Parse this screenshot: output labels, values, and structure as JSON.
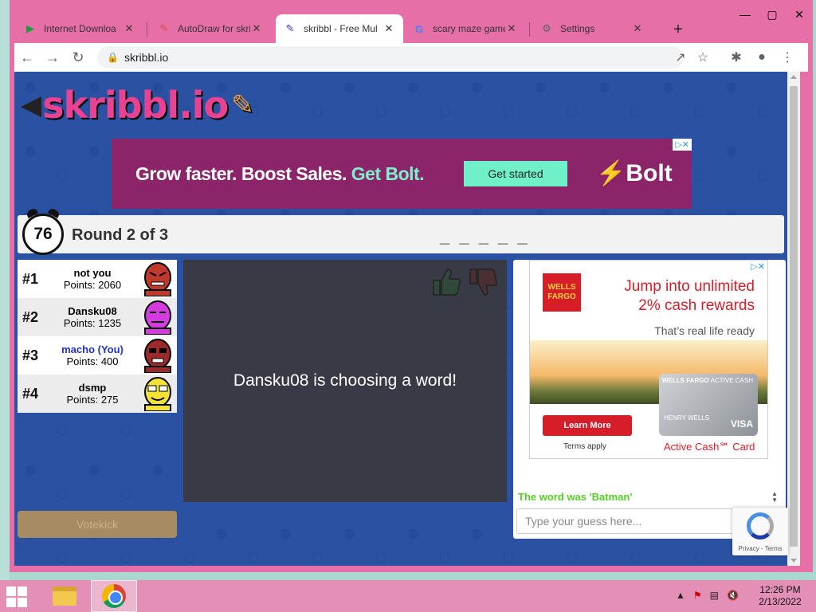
{
  "browser": {
    "tabs": [
      {
        "title": "Internet Downloa",
        "icon": "play-icon"
      },
      {
        "title": "AutoDraw for skri",
        "icon": "autodraw-icon"
      },
      {
        "title": "skribbl - Free Mul",
        "icon": "pencil-icon"
      },
      {
        "title": "scary maze game",
        "icon": "google-icon"
      },
      {
        "title": "Settings",
        "icon": "gear-icon"
      }
    ],
    "url": "skribbl.io"
  },
  "game": {
    "logo": "skribbl.io",
    "timer": "76",
    "round": "Round 2 of 3",
    "word_hint": "_ _ _ _ _",
    "canvas_message": "Dansku08 is choosing a word!",
    "votekick": "Votekick",
    "players": [
      {
        "rank": "#1",
        "name": "not you",
        "points": "Points: 2060",
        "color": "#c0392b"
      },
      {
        "rank": "#2",
        "name": "Dansku08",
        "points": "Points: 1235",
        "color": "#d63be0"
      },
      {
        "rank": "#3",
        "name": "macho (You)",
        "points": "Points: 400",
        "color": "#9c2a2a"
      },
      {
        "rank": "#4",
        "name": "dsmp",
        "points": "Points: 275",
        "color": "#f2e233"
      }
    ],
    "chat_message": "The word was 'Batman'",
    "guess_placeholder": "Type your guess here..."
  },
  "ads": {
    "top_headline_a": "Grow faster. Boost Sales.",
    "top_headline_b": "Get Bolt.",
    "top_cta": "Get started",
    "top_brand": "Bolt",
    "side_logo": "WELLS FARGO",
    "side_line1": "Jump into unlimited",
    "side_line2": "2% cash rewards",
    "side_line3": "That’s real life ready",
    "side_cta": "Learn More",
    "side_terms": "Terms apply",
    "side_card_brand": "WELLS FARGO",
    "side_card_type": "ACTIVE CASH",
    "side_card_holder": "HENRY WELLS",
    "side_card_network": "VISA",
    "side_card_name": "Active Cash℠ Card"
  },
  "recaptcha": {
    "text": "Privacy - Terms"
  },
  "taskbar": {
    "time": "12:26 PM",
    "date": "2/13/2022"
  }
}
